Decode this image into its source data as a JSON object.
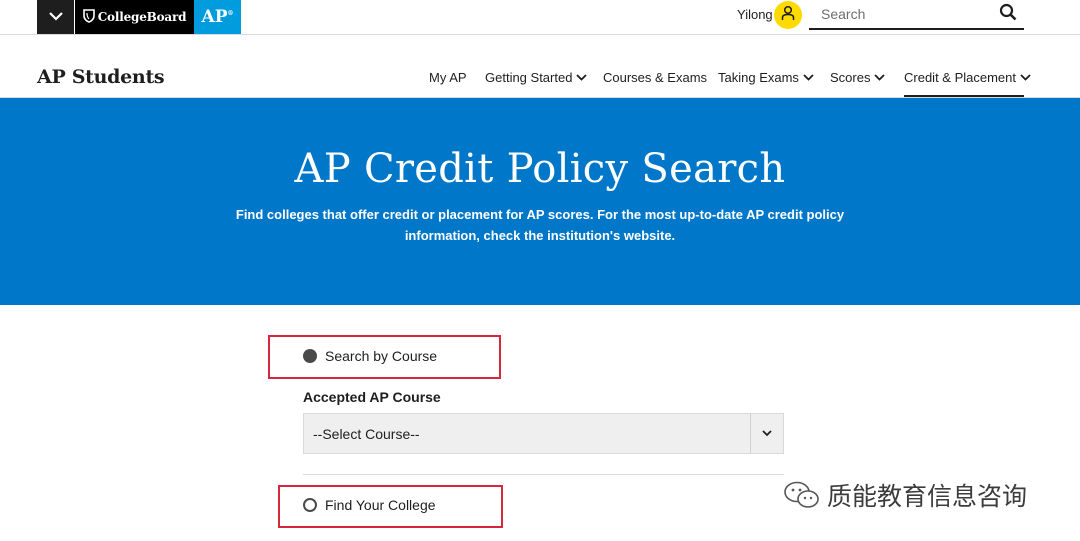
{
  "utility_bar": {
    "brand_collegeboard": "CollegeBoard",
    "brand_ap": "AP",
    "user_name": "Yilong",
    "search": {
      "placeholder": "Search",
      "value": ""
    }
  },
  "nav": {
    "site_title": "AP Students",
    "items": [
      {
        "label": "My AP",
        "has_dropdown": false,
        "active": false
      },
      {
        "label": "Getting Started",
        "has_dropdown": true,
        "active": false
      },
      {
        "label": "Courses & Exams",
        "has_dropdown": false,
        "active": false
      },
      {
        "label": "Taking Exams",
        "has_dropdown": true,
        "active": false
      },
      {
        "label": "Scores",
        "has_dropdown": true,
        "active": false
      },
      {
        "label": "Credit & Placement",
        "has_dropdown": true,
        "active": true
      }
    ]
  },
  "hero": {
    "title": "AP Credit Policy Search",
    "subtitle": "Find colleges that offer credit or placement for AP scores. For the most up-to-date AP credit policy information, check the institution's website."
  },
  "form": {
    "option_search_by_course": {
      "label": "Search by Course",
      "checked": true
    },
    "course_field": {
      "label": "Accepted AP Course",
      "selected": "--Select Course--"
    },
    "option_find_college": {
      "label": "Find Your College",
      "checked": false
    }
  },
  "watermark": {
    "text": "质能教育信息咨询"
  },
  "colors": {
    "brand_blue": "#0077c8",
    "ap_blue": "#009cde",
    "avatar_yellow": "#fedb00",
    "highlight_red": "#d6283c",
    "dark": "#1e1e1e"
  }
}
